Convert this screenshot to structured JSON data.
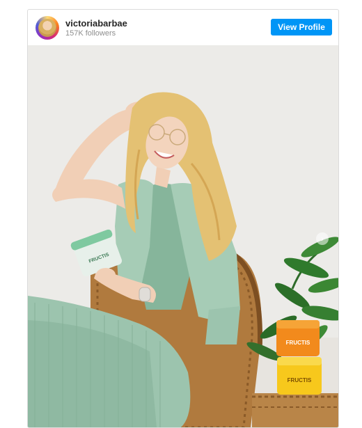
{
  "profile": {
    "username": "victoriabarbae",
    "followers": "157K followers",
    "view_profile_label": "View Profile"
  },
  "photo": {
    "products": {
      "jar_left_label": "FRUCTIS",
      "jar_top_label": "FRUCTIS",
      "jar_bottom_label": "FRUCTIS"
    }
  },
  "colors": {
    "button_blue": "#0095f6",
    "outfit_green": "#9bc2ad",
    "wall": "#ecebe8"
  },
  "icons": {
    "next": "chevron-right-icon"
  }
}
